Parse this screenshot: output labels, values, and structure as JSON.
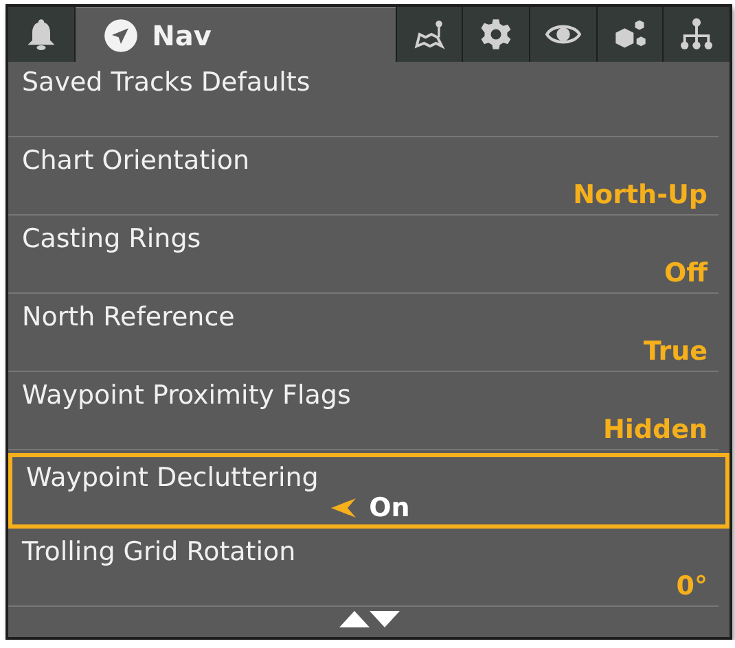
{
  "tabs": [
    {
      "kind": "bell",
      "selected": false
    },
    {
      "kind": "nav",
      "label": "Nav",
      "selected": true
    },
    {
      "kind": "map",
      "selected": false
    },
    {
      "kind": "gear",
      "selected": false
    },
    {
      "kind": "eye",
      "selected": false
    },
    {
      "kind": "boxes",
      "selected": false
    },
    {
      "kind": "network",
      "selected": false
    }
  ],
  "items": [
    {
      "label": "Saved Tracks Defaults",
      "selected": false
    },
    {
      "label": "Chart Orientation",
      "value": "North-Up",
      "selected": false
    },
    {
      "label": "Casting Rings",
      "value": "Off",
      "selected": false
    },
    {
      "label": "North Reference",
      "value": "True",
      "selected": false
    },
    {
      "label": "Waypoint Proximity Flags",
      "value": "Hidden",
      "selected": false
    },
    {
      "label": "Waypoint Decluttering",
      "value": "On",
      "selected": true
    },
    {
      "label": "Trolling Grid Rotation",
      "value": "0°",
      "selected": false
    }
  ]
}
